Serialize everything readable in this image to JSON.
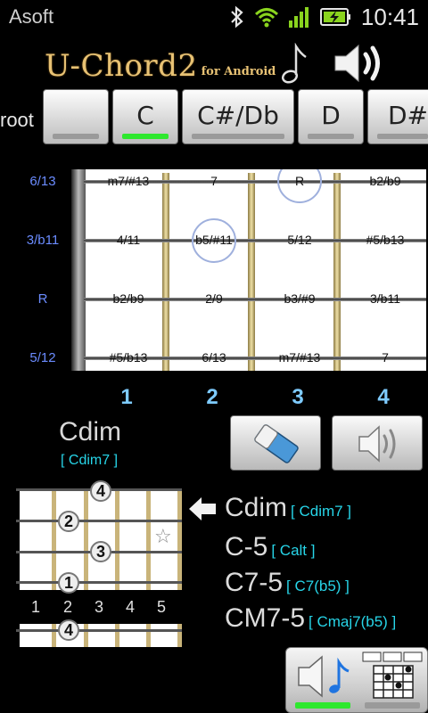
{
  "status_bar": {
    "app_name": "Asoft",
    "time": "10:41",
    "icons": [
      "bluetooth-icon",
      "wifi-icon",
      "signal-icon",
      "battery-charging-icon"
    ]
  },
  "header": {
    "title": "U-Chord2",
    "subtitle": "for Android",
    "note_icon": "music-note-icon",
    "speaker_icon": "speaker-icon"
  },
  "root_row": {
    "label": "root",
    "buttons": [
      {
        "label": "",
        "selected": false
      },
      {
        "label": "C",
        "selected": true
      },
      {
        "label": "C#/Db",
        "selected": false
      },
      {
        "label": "D",
        "selected": false
      },
      {
        "label": "D#/",
        "selected": false
      }
    ]
  },
  "fretboard": {
    "string_labels": [
      "6/13",
      "3/b11",
      "R",
      "5/12"
    ],
    "rows": [
      [
        "m7/#13",
        "7",
        "R",
        "b2/b9"
      ],
      [
        "4/11",
        "b5/#11",
        "5/12",
        "#5/b13"
      ],
      [
        "b2/b9",
        "2/9",
        "b3/#9",
        "3/b11"
      ],
      [
        "#5/b13",
        "6/13",
        "m7/#13",
        "7"
      ]
    ],
    "fret_numbers": [
      "1",
      "2",
      "3",
      "4"
    ],
    "colors": {
      "board": "#ffffff",
      "frets": "#c9b47a",
      "strings": "#6e6e6e",
      "fret_numbers": "#7ecbff"
    }
  },
  "chord": {
    "name": "Cdim",
    "alias": "[ Cdim7 ]"
  },
  "tools": {
    "erase_icon": "eraser-icon",
    "play_icon": "speaker-icon"
  },
  "mini_diagram": {
    "fingers": [
      "4",
      "2",
      "3",
      "1"
    ],
    "fret_numbers": [
      "1",
      "2",
      "3",
      "4",
      "5"
    ],
    "star": "☆",
    "next_finger": "4"
  },
  "chord_list": {
    "arrow_icon": "arrow-left-icon",
    "items": [
      {
        "name": "Cdim",
        "alias": "[ Cdim7 ]"
      },
      {
        "name": "C-5",
        "alias": "[ Calt ]"
      },
      {
        "name": "C7-5",
        "alias": "[ C7(b5) ]"
      },
      {
        "name": "CM7-5",
        "alias": "[ Cmaj7(b5) ]"
      }
    ]
  },
  "bottom_panel": {
    "sound_icon": "speaker-note-icon",
    "diagram_icon": "chord-diagram-icon"
  },
  "accent_colors": {
    "selected": "#2ee82e",
    "alias_text": "#27d5e8",
    "string_labels": "#6b8cff",
    "title": "#e8c274"
  }
}
